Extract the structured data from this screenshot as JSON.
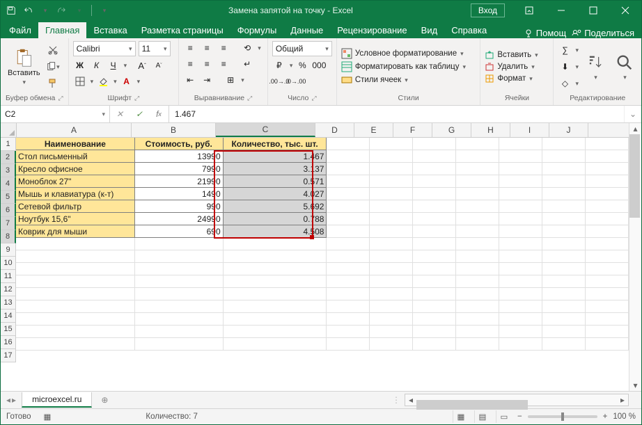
{
  "title": "Замена запятой на точку  -  Excel",
  "signIn": "Вход",
  "tabs": {
    "file": "Файл",
    "home": "Главная",
    "insert": "Вставка",
    "layout": "Разметка страницы",
    "formulas": "Формулы",
    "data": "Данные",
    "review": "Рецензирование",
    "view": "Вид",
    "help": "Справка",
    "tellme": "Помощ",
    "share": "Поделиться"
  },
  "ribbon": {
    "clipboard": {
      "title": "Буфер обмена",
      "paste": "Вставить"
    },
    "font": {
      "title": "Шрифт",
      "name": "Calibri",
      "size": "11",
      "bold": "Ж",
      "italic": "К",
      "underline": "Ч"
    },
    "align": {
      "title": "Выравнивание"
    },
    "number": {
      "title": "Число",
      "format": "Общий"
    },
    "styles": {
      "title": "Стили",
      "cond": "Условное форматирование",
      "table": "Форматировать как таблицу",
      "cell": "Стили ячеек"
    },
    "cellsGrp": {
      "title": "Ячейки",
      "insert": "Вставить",
      "delete": "Удалить",
      "format": "Формат"
    },
    "editing": {
      "title": "Редактирование"
    }
  },
  "nameBox": "C2",
  "formula": "1.467",
  "cols": [
    "A",
    "B",
    "C",
    "D",
    "E",
    "F",
    "G",
    "H",
    "I",
    "J"
  ],
  "headers": {
    "a": "Наименование",
    "b": "Стоимость, руб.",
    "c": "Количество, тыс. шт."
  },
  "rows": [
    {
      "n": "2",
      "a": "Стол письменный",
      "b": "13990",
      "c": "1.467"
    },
    {
      "n": "3",
      "a": "Кресло офисное",
      "b": "7990",
      "c": "3.137"
    },
    {
      "n": "4",
      "a": "Моноблок 27\"",
      "b": "21990",
      "c": "0.571"
    },
    {
      "n": "5",
      "a": "Мышь и клавиатура (к-т)",
      "b": "1490",
      "c": "4.027"
    },
    {
      "n": "6",
      "a": "Сетевой фильтр",
      "b": "990",
      "c": "5.692"
    },
    {
      "n": "7",
      "a": "Ноутбук 15,6\"",
      "b": "24990",
      "c": "0.788"
    },
    {
      "n": "8",
      "a": "Коврик для мыши",
      "b": "690",
      "c": "4.508"
    }
  ],
  "emptyRows": [
    "9",
    "10",
    "11",
    "12",
    "13",
    "14",
    "15",
    "16",
    "17"
  ],
  "sheet": "microexcel.ru",
  "status": {
    "ready": "Готово",
    "count": "Количество: 7",
    "zoom": "100 %"
  }
}
